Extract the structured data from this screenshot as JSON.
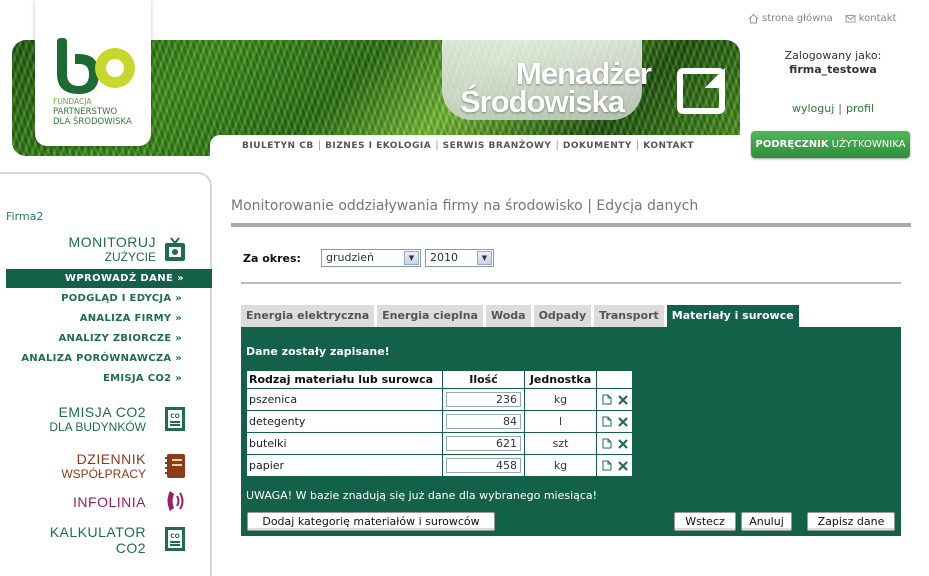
{
  "logo": {
    "line1": "FUNDACJA",
    "line2": "PARTNERSTWO",
    "line3": "DLA ŚRODOWISKA"
  },
  "brand": {
    "line1": "Menadżer",
    "line2": "Środowiska"
  },
  "topnav": [
    "BIULETYN CB",
    "BIZNES I EKOLOGIA",
    "SERWIS BRANŻOWY",
    "DOKUMENTY",
    "KONTAKT"
  ],
  "util": {
    "home": "strona główna",
    "contact": "kontakt"
  },
  "login": {
    "label": "Zalogowany jako:",
    "user": "firma_testowa",
    "logout": "wyloguj",
    "profile": "profil"
  },
  "manual": {
    "bold": "PODRĘCZNIK",
    "rest": "UŻYTKOWNIKA"
  },
  "sidebar": {
    "firm": "Firma2",
    "monitor": {
      "t1": "MONITORUJ",
      "t2": "ZUŻYCIE"
    },
    "sub": [
      "WPROWADŹ DANE »",
      "PODGLĄD I EDYCJA »",
      "ANALIZA FIRMY »",
      "ANALIZY ZBIORCZE »",
      "ANALIZA PORÓWNAWCZA »",
      "EMISJA CO2 »"
    ],
    "emisja": {
      "t1": "EMISJA CO2",
      "t2": "DLA BUDYNKÓW"
    },
    "dziennik": {
      "t1": "DZIENNIK",
      "t2": "WSPÓŁPRACY"
    },
    "infolinia": {
      "t1": "INFOLINIA"
    },
    "kalkulator": {
      "t1": "KALKULATOR",
      "t2": "CO2"
    },
    "colors": {
      "green": "#1e6e4e",
      "brown": "#8b3a1a",
      "purple": "#9b1d6b"
    }
  },
  "main": {
    "title": "Monitorowanie oddziaływania firmy na środowisko | Edycja danych",
    "period_label": "Za okres:",
    "month": "grudzień",
    "year": "2010",
    "tabs": [
      "Energia elektryczna",
      "Energia cieplna",
      "Woda",
      "Odpady",
      "Transport",
      "Materiały i surowce"
    ],
    "active_tab": 5,
    "saved": "Dane zostały zapisane!",
    "table": {
      "headers": [
        "Rodzaj materiału lub surowca",
        "Ilość",
        "Jednostka",
        ""
      ],
      "rows": [
        {
          "name": "pszenica",
          "qty": "236",
          "unit": "kg"
        },
        {
          "name": "detegenty",
          "qty": "84",
          "unit": "l"
        },
        {
          "name": "butelki",
          "qty": "621",
          "unit": "szt"
        },
        {
          "name": "papier",
          "qty": "458",
          "unit": "kg"
        }
      ]
    },
    "warning": "UWAGA! W bazie znadują się już dane dla wybranego miesiąca!",
    "buttons": {
      "add": "Dodaj kategorię materiałów i surowców",
      "back": "Wstecz",
      "cancel": "Anuluj",
      "save": "Zapisz dane"
    }
  }
}
